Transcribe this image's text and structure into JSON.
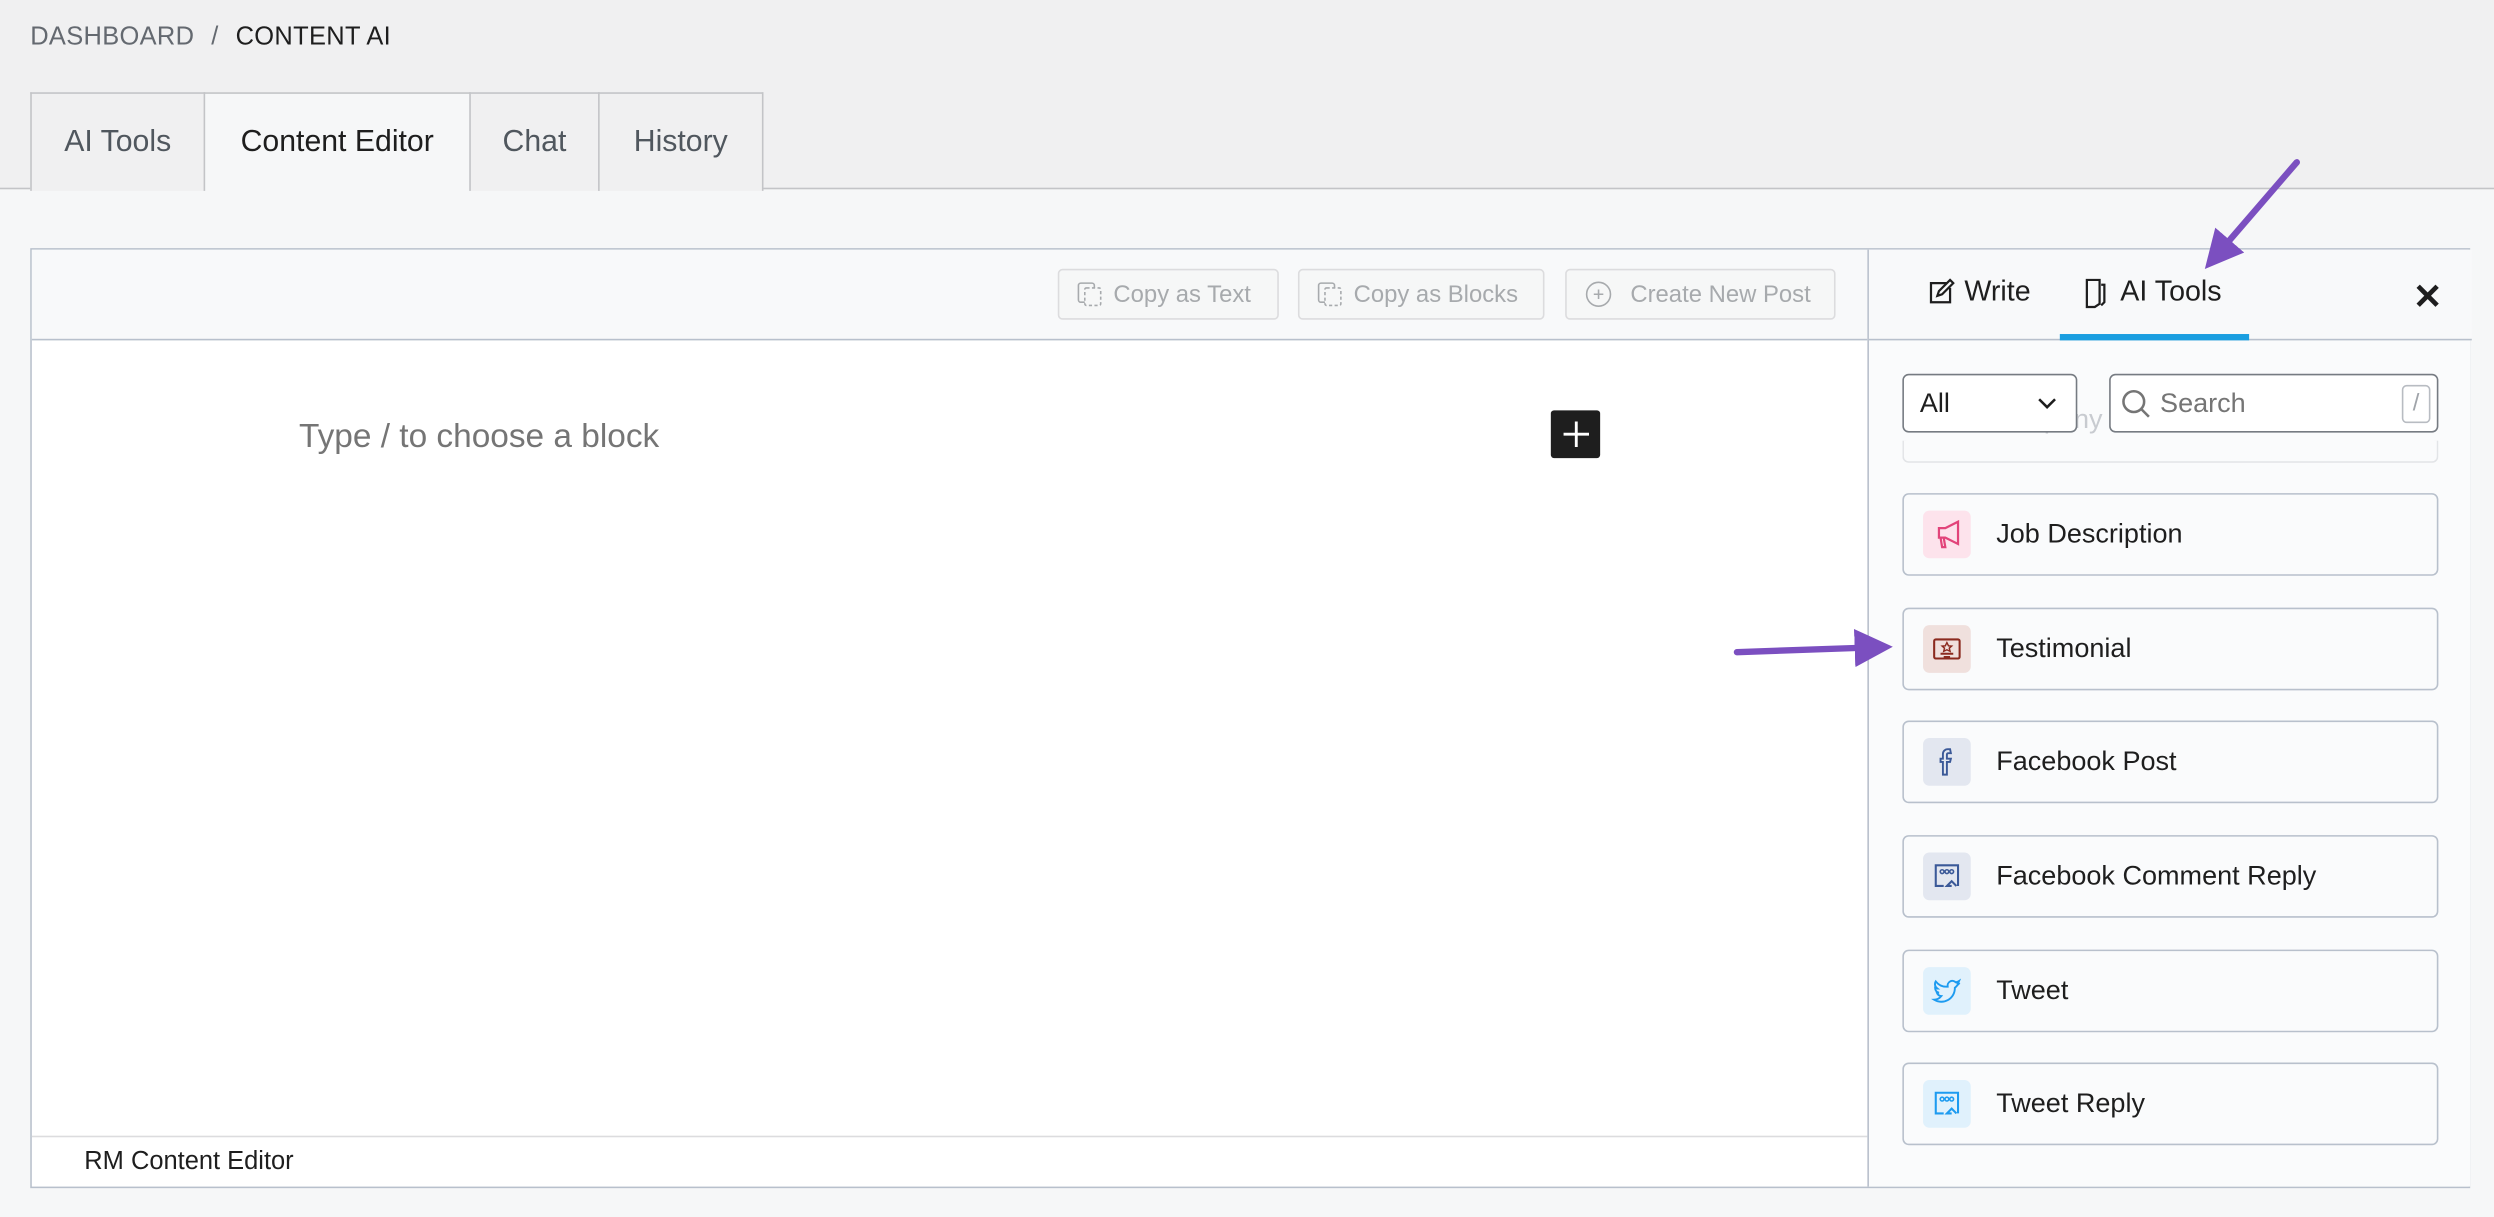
{
  "breadcrumb": {
    "parent": "DASHBOARD",
    "separator": "/",
    "current": "CONTENT AI"
  },
  "tabs": [
    {
      "label": "AI Tools"
    },
    {
      "label": "Content Editor",
      "active": true
    },
    {
      "label": "Chat"
    },
    {
      "label": "History"
    }
  ],
  "toolbar": {
    "copy_text": "Copy as Text",
    "copy_blocks": "Copy as Blocks",
    "create_post": "Create New Post"
  },
  "editor": {
    "placeholder": "Type / to choose a block",
    "footer": "RM Content Editor"
  },
  "sidebar": {
    "tabs": [
      {
        "label": "Write",
        "icon": "edit-icon"
      },
      {
        "label": "AI Tools",
        "icon": "document-icon",
        "active": true
      }
    ],
    "accent": "#1a9ee0",
    "filter": {
      "value": "All"
    },
    "search": {
      "placeholder": "Search",
      "shortcut": "/"
    },
    "partial_item": "pany",
    "items": [
      {
        "label": "Job Description",
        "icon": "megaphone-icon",
        "color": "#e2447a",
        "bg": "#fde3ec"
      },
      {
        "label": "Testimonial",
        "icon": "certificate-icon",
        "color": "#8b2a1f",
        "bg": "#f0e0dd"
      },
      {
        "label": "Facebook Post",
        "icon": "facebook-icon",
        "color": "#3b5998",
        "bg": "#e3e7f0"
      },
      {
        "label": "Facebook Comment Reply",
        "icon": "comment-reply-icon",
        "color": "#3b5998",
        "bg": "#e3e7f0"
      },
      {
        "label": "Tweet",
        "icon": "twitter-icon",
        "color": "#1d9bf0",
        "bg": "#e0f1fc"
      },
      {
        "label": "Tweet Reply",
        "icon": "comment-reply-icon",
        "color": "#1d9bf0",
        "bg": "#e0f1fc"
      }
    ]
  },
  "annotation_color": "#7b4fc0"
}
